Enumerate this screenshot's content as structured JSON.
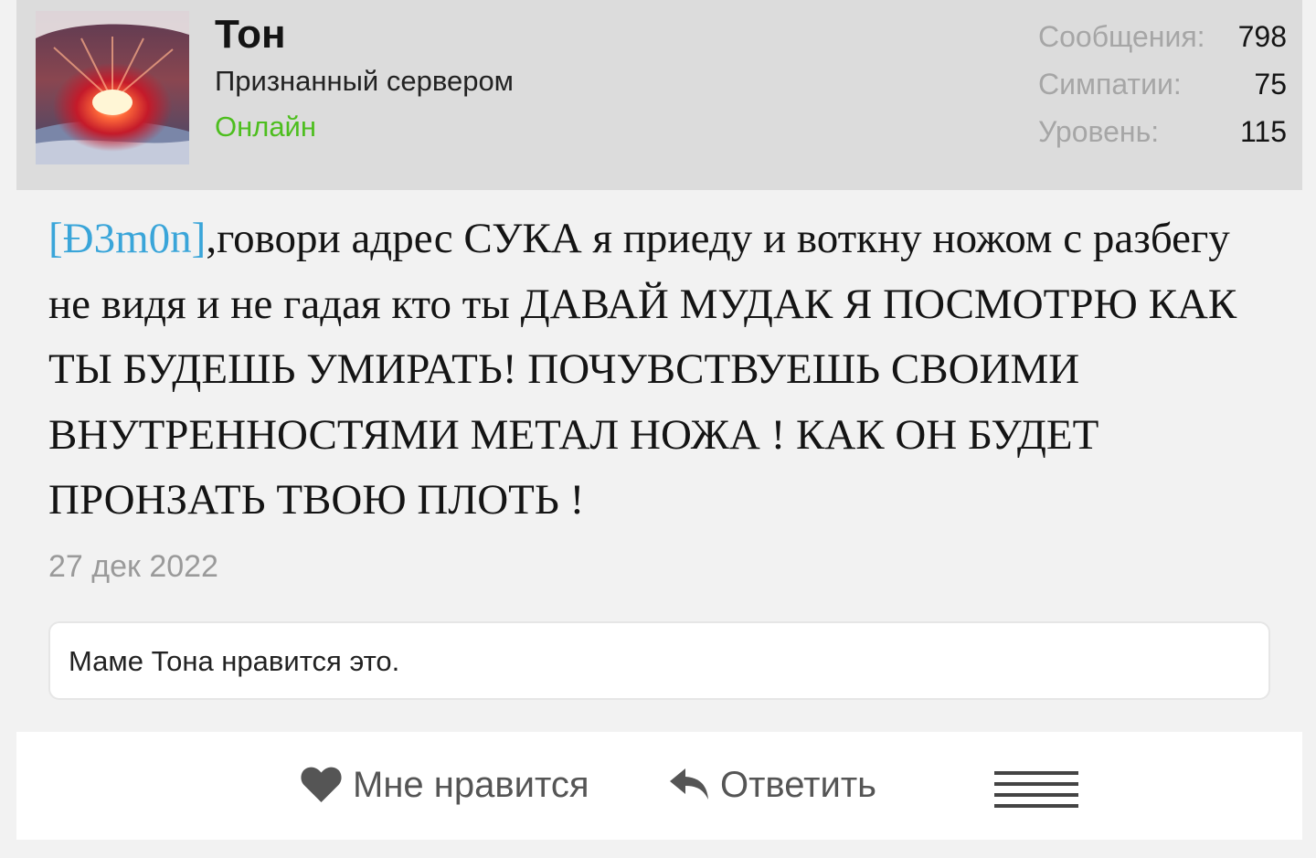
{
  "user": {
    "name": "Тон",
    "title": "Признанный сервером",
    "status": "Онлайн",
    "avatar_icon": "avatar-image"
  },
  "stats": [
    {
      "label": "Сообщения:",
      "value": "798"
    },
    {
      "label": "Симпатии:",
      "value": "75"
    },
    {
      "label": "Уровень:",
      "value": "115"
    }
  ],
  "post": {
    "mention": "[Đ3m0n]",
    "text": ",говори адрес СУКА я приеду и воткну ножом с разбегу не видя и не гадая кто ты ДАВАЙ МУДАК Я ПОСМОТРЮ КАК ТЫ БУДЕШЬ УМИРАТЬ! ПОЧУВСТВУЕШЬ СВОИМИ ВНУТРЕННОСТЯМИ МЕТАЛ НОЖА ! КАК ОН БУДЕТ ПРОНЗАТЬ ТВОЮ ПЛОТЬ !",
    "date": "27 дек 2022"
  },
  "likes": {
    "text": "Маме Тона нравится это."
  },
  "actions": {
    "like_label": "Мне нравится",
    "reply_label": "Ответить",
    "like_icon": "heart-icon",
    "reply_icon": "reply-arrow-icon",
    "menu_icon": "menu-icon"
  },
  "colors": {
    "header_bg": "#dcdcdc",
    "online": "#4dbe1e",
    "mention": "#3aa5d9",
    "muted": "#a6a6a6"
  }
}
